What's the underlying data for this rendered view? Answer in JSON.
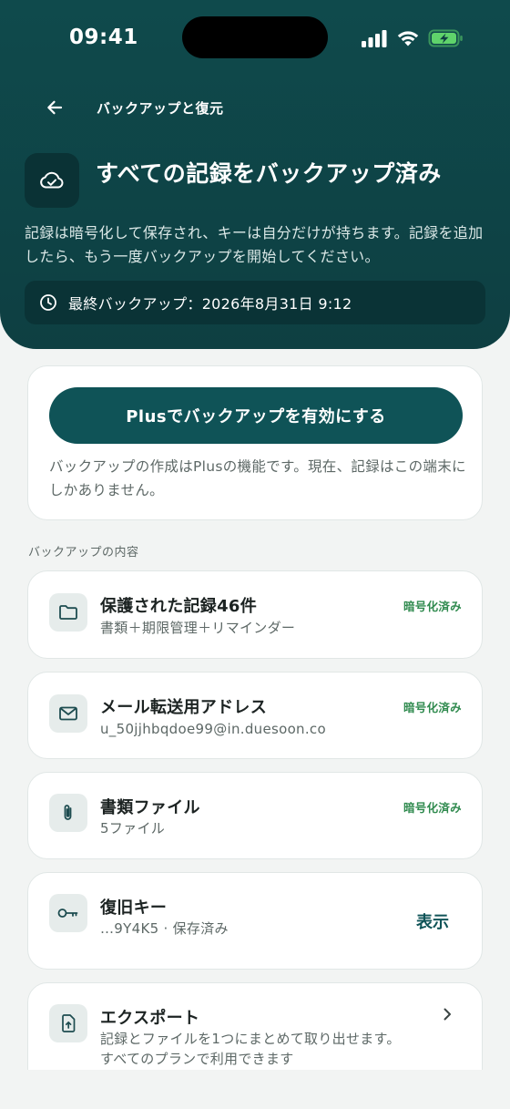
{
  "status": {
    "time": "09:41"
  },
  "nav": {
    "title": "バックアップと復元"
  },
  "hero": {
    "title": "すべての記録をバックアップ済み",
    "description": "記録は暗号化して保存され、キーは自分だけが持ちます。記録を追加したら、もう一度バックアップを開始してください。",
    "last_backup": "最終バックアップ：2026年8月31日 9:12"
  },
  "plus": {
    "button_label": "Plusでバックアップを有効にする",
    "description": "バックアップの作成はPlusの機能です。現在、記録はこの端末にしかありません。"
  },
  "contents": {
    "section_label": "バックアップの内容",
    "items": [
      {
        "title": "保護された記録46件",
        "subtitle": "書類＋期限管理＋リマインダー",
        "badge": "暗号化済み",
        "icon": "folder-icon"
      },
      {
        "title": "メール転送用アドレス",
        "subtitle": "u_50jjhbqdoe99@in.duesoon.co",
        "badge": "暗号化済み",
        "icon": "mail-icon"
      },
      {
        "title": "書類ファイル",
        "subtitle": "5ファイル",
        "badge": "暗号化済み",
        "icon": "paperclip-icon"
      },
      {
        "title": "復旧キー",
        "subtitle": "…9Y4K5 · 保存済み",
        "action": "表示",
        "icon": "key-icon"
      },
      {
        "title": "エクスポート",
        "subtitle_line1": "記録とファイルを1つにまとめて取り出せます。",
        "subtitle_line2": "すべてのプランで利用できます",
        "icon": "export-icon"
      }
    ]
  },
  "colors": {
    "header_bg": "#0f4a4c",
    "primary": "#0f5357",
    "badge_green": "#2f8a4e",
    "battery_green": "#5fd36b"
  }
}
